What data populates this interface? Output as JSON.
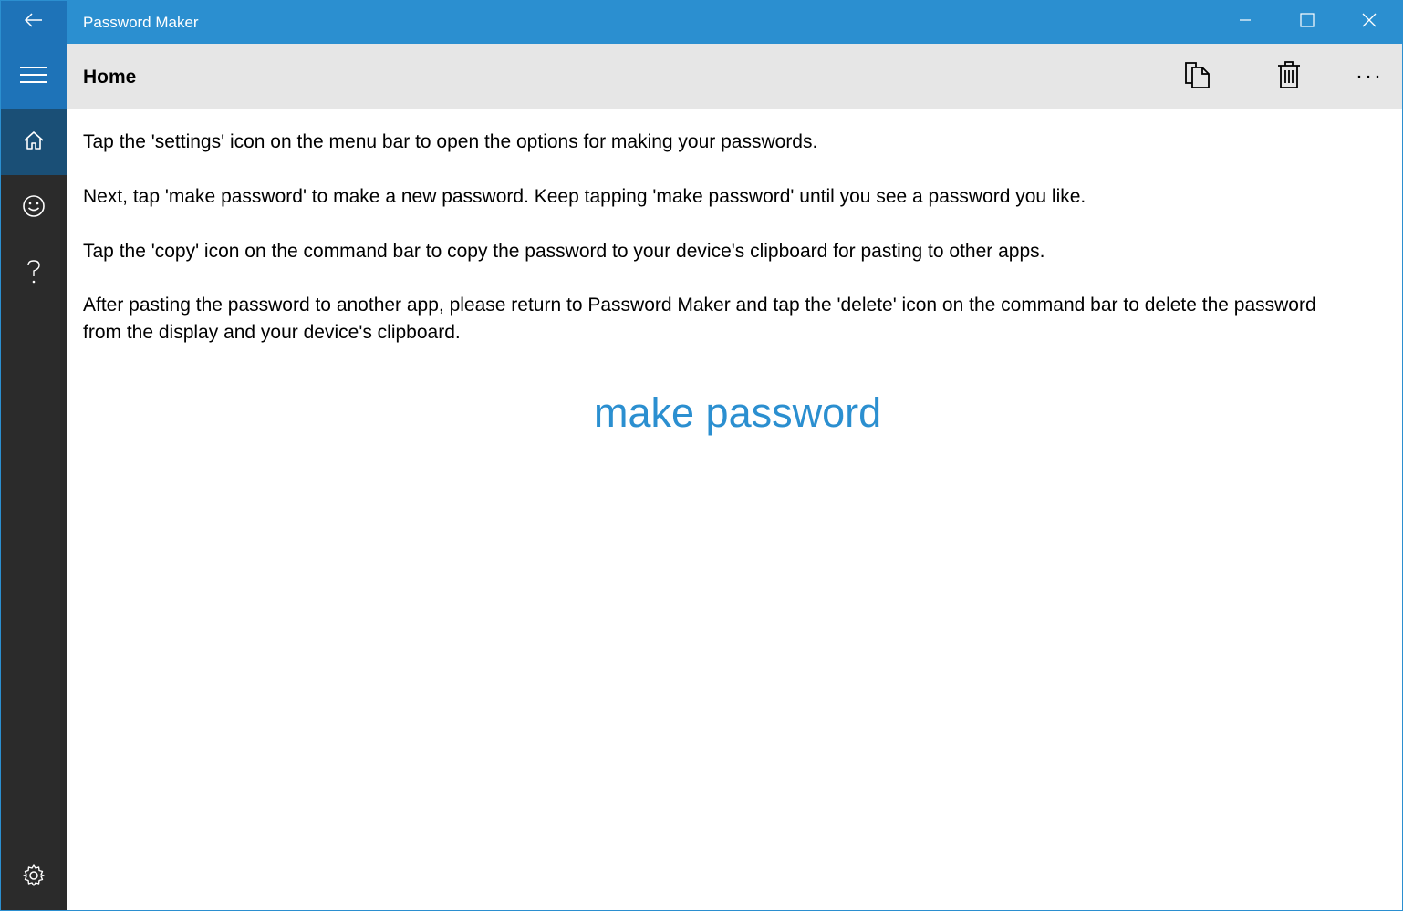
{
  "window": {
    "title": "Password Maker",
    "accent_color": "#2b8fd0",
    "nav_color": "#2b2b2b"
  },
  "titlebar": {
    "back_icon": "back-arrow-icon",
    "minimize_icon": "minimize-icon",
    "maximize_icon": "maximize-icon",
    "close_icon": "close-icon"
  },
  "nav": {
    "menu_icon": "hamburger-icon",
    "items": [
      {
        "icon": "home-icon",
        "selected": true
      },
      {
        "icon": "smiley-icon",
        "selected": false
      },
      {
        "icon": "question-icon",
        "selected": false
      }
    ],
    "settings_icon": "gear-icon"
  },
  "commandbar": {
    "page_title": "Home",
    "copy_icon": "copy-icon",
    "delete_icon": "trash-icon",
    "more_label": "···"
  },
  "content": {
    "paragraphs": [
      "Tap the 'settings' icon on the menu bar to open the options for making your passwords.",
      "Next, tap 'make password' to make a new password. Keep tapping 'make password' until you see a password you like.",
      "Tap the 'copy' icon on the command bar to copy the password to your device's clipboard for pasting to other apps.",
      "After pasting the password to another app, please return to Password Maker and tap the 'delete' icon on the command bar to delete the password from the display and your device's clipboard."
    ],
    "make_password_label": "make password"
  }
}
